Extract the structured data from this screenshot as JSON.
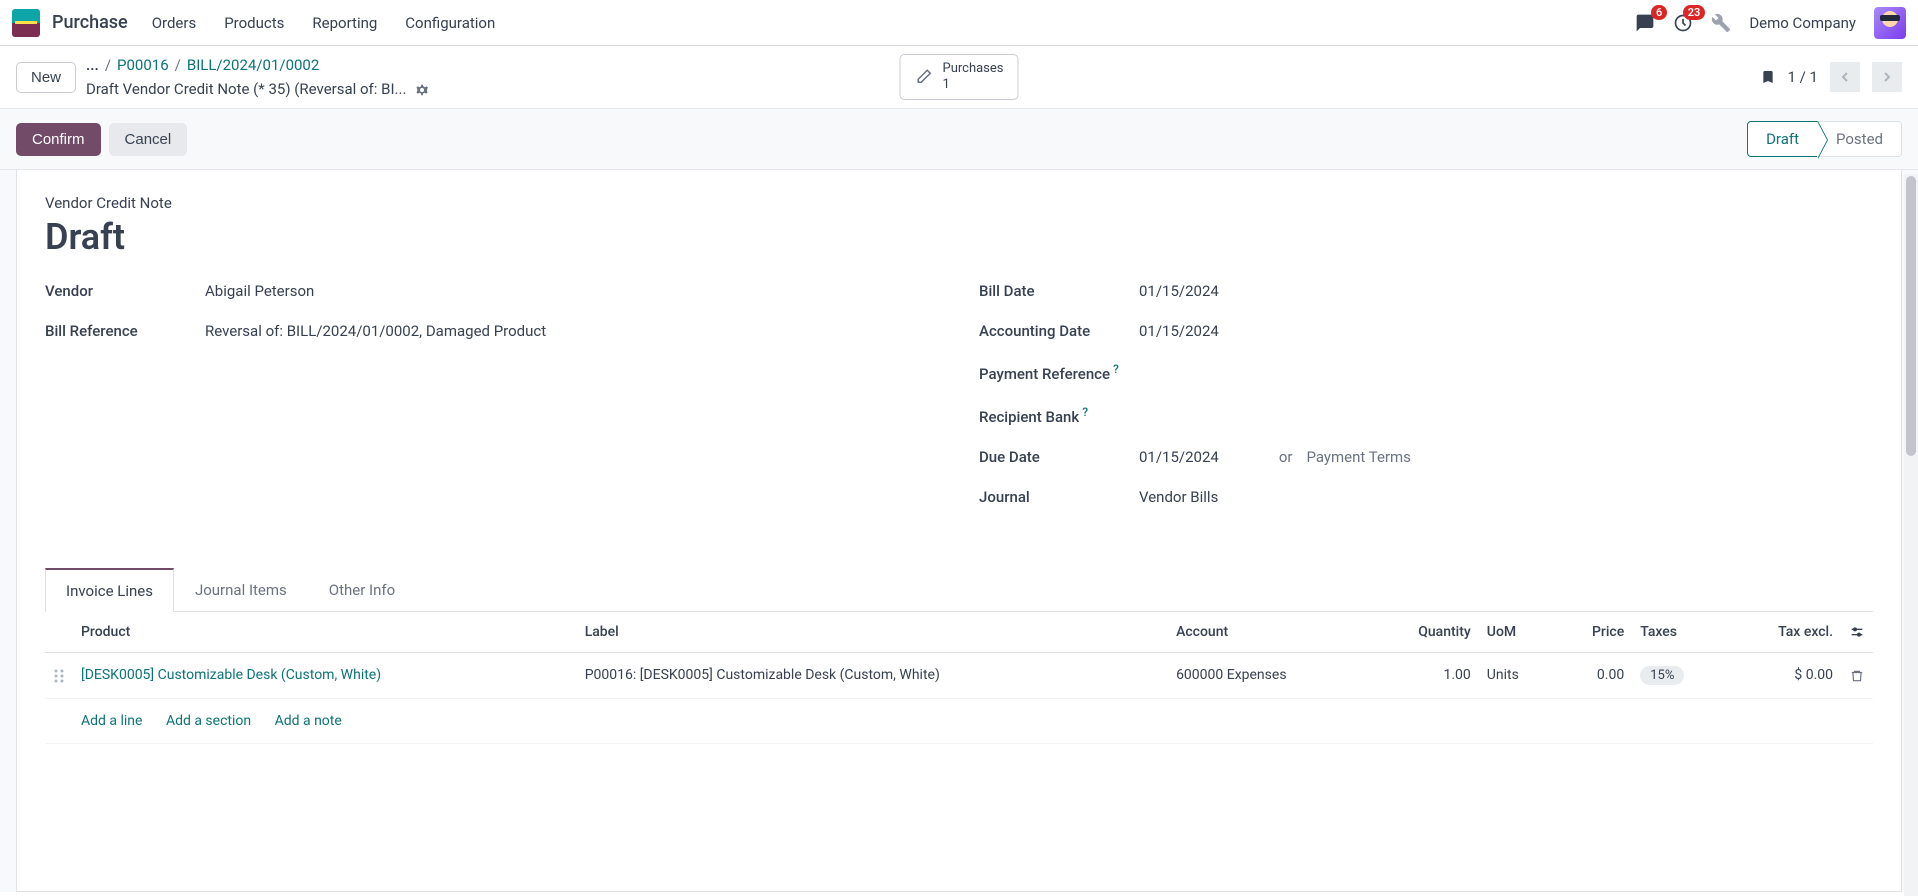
{
  "nav": {
    "app_name": "Purchase",
    "menu": [
      "Orders",
      "Products",
      "Reporting",
      "Configuration"
    ],
    "company": "Demo Company",
    "msg_badge": "6",
    "activity_badge": "23"
  },
  "control": {
    "new_label": "New",
    "breadcrumb_dots": "...",
    "breadcrumb": [
      "P00016",
      "BILL/2024/01/0002"
    ],
    "subtitle": "Draft Vendor Credit Note (* 35) (Reversal of: BI...",
    "stat_label": "Purchases",
    "stat_value": "1",
    "pager": "1 / 1"
  },
  "actions": {
    "confirm": "Confirm",
    "cancel": "Cancel",
    "status": [
      "Draft",
      "Posted"
    ]
  },
  "form": {
    "doc_type": "Vendor Credit Note",
    "doc_state": "Draft",
    "left": {
      "vendor_label": "Vendor",
      "vendor_value": "Abigail Peterson",
      "billref_label": "Bill Reference",
      "billref_value": "Reversal of: BILL/2024/01/0002, Damaged Product"
    },
    "right": {
      "billdate_label": "Bill Date",
      "billdate_value": "01/15/2024",
      "acctdate_label": "Accounting Date",
      "acctdate_value": "01/15/2024",
      "payref_label": "Payment Reference",
      "recbank_label": "Recipient Bank",
      "duedate_label": "Due Date",
      "duedate_value": "01/15/2024",
      "or_label": "or",
      "payterms_placeholder": "Payment Terms",
      "journal_label": "Journal",
      "journal_value": "Vendor Bills"
    }
  },
  "tabs": [
    "Invoice Lines",
    "Journal Items",
    "Other Info"
  ],
  "table": {
    "headers": {
      "product": "Product",
      "label": "Label",
      "account": "Account",
      "quantity": "Quantity",
      "uom": "UoM",
      "price": "Price",
      "taxes": "Taxes",
      "taxexcl": "Tax excl."
    },
    "rows": [
      {
        "product": "[DESK0005] Customizable Desk (Custom, White)",
        "label": "P00016: [DESK0005] Customizable Desk (Custom, White)",
        "account": "600000 Expenses",
        "quantity": "1.00",
        "uom": "Units",
        "price": "0.00",
        "tax": "15%",
        "taxexcl": "$ 0.00"
      }
    ],
    "add_line": "Add a line",
    "add_section": "Add a section",
    "add_note": "Add a note"
  }
}
